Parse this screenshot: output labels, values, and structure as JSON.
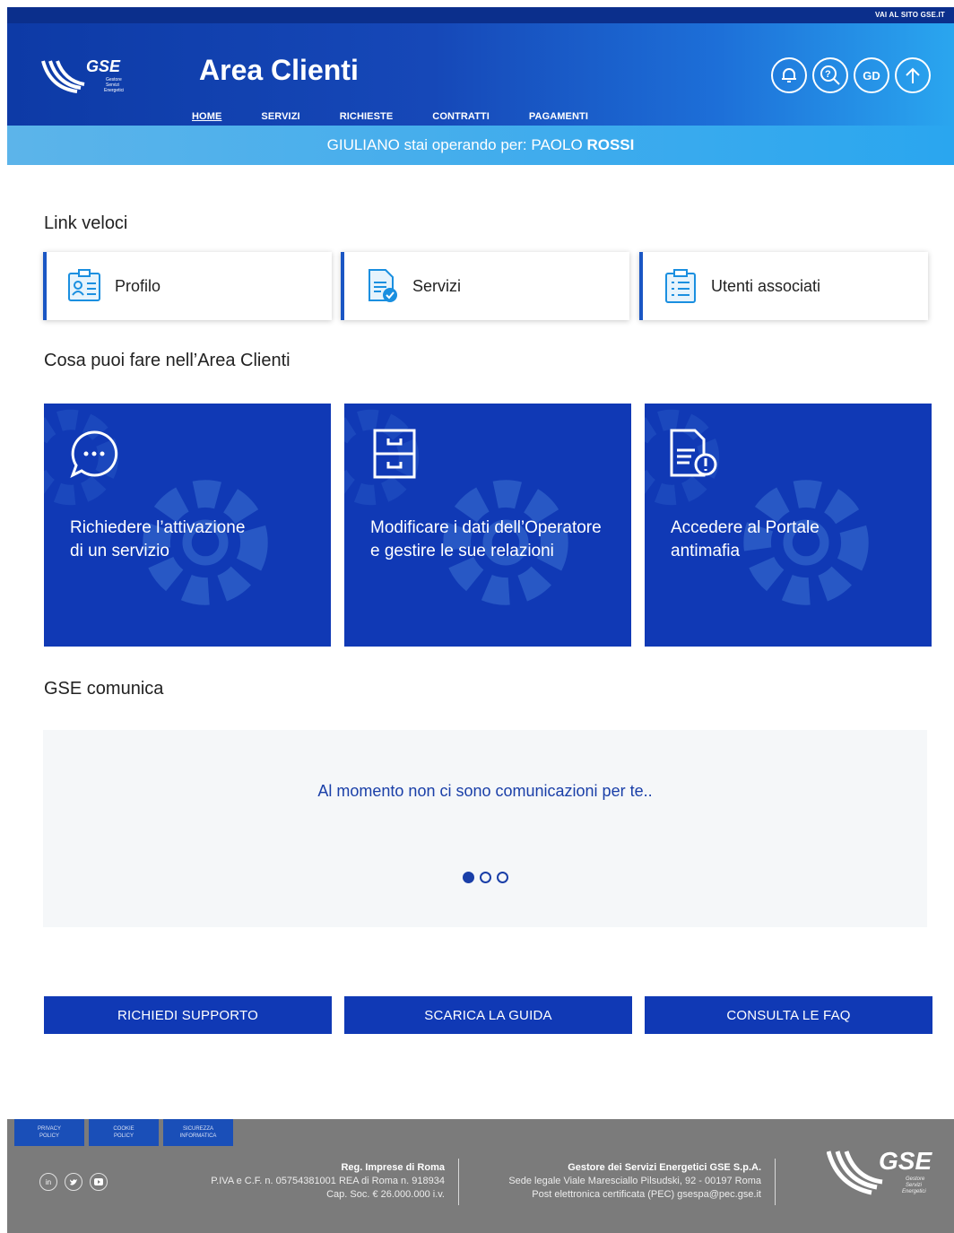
{
  "topbar": {
    "link": "VAI AL SITO GSE.IT"
  },
  "header": {
    "logo_text": "GSE",
    "logo_sub": "Gestore Servizi Energetici",
    "title": "Area Clienti",
    "nav": [
      "HOME",
      "SERVIZI",
      "RICHIESTE",
      "CONTRATTI",
      "PAGAMENTI"
    ],
    "icons": [
      "notifications-icon",
      "help-icon",
      "user-initials-icon",
      "upload-icon"
    ],
    "user_initials": "GD"
  },
  "operator_bar": {
    "user": "GIULIANO",
    "text": "stai operando per:",
    "operator": "PAOLO",
    "operator_surname": "ROSSI"
  },
  "quick_links": {
    "title": "Link veloci",
    "items": [
      {
        "label": "Profilo",
        "icon": "profile-card-icon"
      },
      {
        "label": "Servizi",
        "icon": "document-check-icon"
      },
      {
        "label": "Utenti associati",
        "icon": "clipboard-list-icon"
      }
    ]
  },
  "actions": {
    "title": "Cosa puoi fare nell’Area Clienti",
    "items": [
      {
        "line1": "Richiedere l’attivazione",
        "line2": "di un servizio",
        "icon": "chat-bubble-icon"
      },
      {
        "line1": "Modificare i dati dell’Operatore",
        "line2": "e gestire le sue relazioni",
        "icon": "file-cabinet-icon"
      },
      {
        "line1": "Accedere al Portale",
        "line2": "antimafia",
        "icon": "document-alert-icon"
      }
    ]
  },
  "comms": {
    "title": "GSE comunica",
    "message": "Al momento non ci sono comunicazioni per te..",
    "pages": 3,
    "active_page": 1
  },
  "buttons": [
    "RICHIEDI SUPPORTO",
    "SCARICA LA GUIDA",
    "CONSULTA LE FAQ"
  ],
  "footer": {
    "links": [
      [
        "PRIVACY",
        "POLICY"
      ],
      [
        "COOKIE",
        "POLICY"
      ],
      [
        "SICUREZZA",
        "INFORMATICA"
      ]
    ],
    "socials": [
      "in",
      "tw",
      "yt"
    ],
    "registry": {
      "title": "Reg. Imprese di Roma",
      "line1": "P.IVA e C.F. n. 05754381001 REA di Roma n. 918934",
      "line2": "Cap. Soc. € 26.000.000 i.v."
    },
    "company": {
      "title": "Gestore dei Servizi Energetici GSE S.p.A.",
      "line1": "Sede legale Viale Maresciallo Pilsudski, 92 - 00197 Roma",
      "line2": "Post elettronica certificata (PEC) gsespa@pec.gse.it"
    }
  }
}
